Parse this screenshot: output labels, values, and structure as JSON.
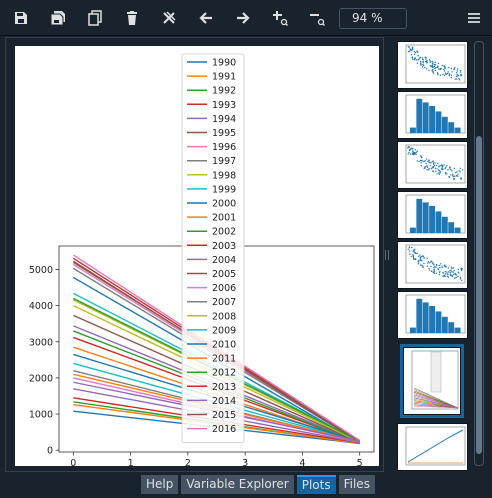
{
  "toolbar": {
    "icons": [
      "save-icon",
      "save-all-icon",
      "copy-icon",
      "delete-icon",
      "delete-all-icon",
      "previous-icon",
      "next-icon",
      "zoom-in-icon",
      "zoom-out-icon",
      "menu-icon"
    ],
    "zoom": "94 %"
  },
  "tabs": [
    {
      "label": "Help",
      "active": false
    },
    {
      "label": "Variable Explorer",
      "active": false
    },
    {
      "label": "Plots",
      "active": true
    },
    {
      "label": "Files",
      "active": false
    }
  ],
  "thumbnails": [
    "scatter",
    "histogram",
    "scatter",
    "histogram",
    "scatter",
    "histogram",
    "line-legend",
    "line"
  ],
  "chart_data": {
    "type": "line",
    "title": "",
    "xlabel": "",
    "ylabel": "",
    "x": [
      0,
      5
    ],
    "xlim": [
      -0.25,
      5.25
    ],
    "ylim": [
      -50,
      5650
    ],
    "xticks": [
      "0",
      "1",
      "2",
      "3",
      "4",
      "5"
    ],
    "yticks": [
      "0",
      "1000",
      "2000",
      "3000",
      "4000",
      "5000"
    ],
    "legend_location": "upper center",
    "series": [
      {
        "name": "1990",
        "color": "#1f77b4",
        "values": [
          4780,
          200
        ]
      },
      {
        "name": "1991",
        "color": "#ff7f0e",
        "values": [
          2850,
          205
        ]
      },
      {
        "name": "1992",
        "color": "#2ca02c",
        "values": [
          1340,
          180
        ]
      },
      {
        "name": "1993",
        "color": "#d62728",
        "values": [
          3120,
          210
        ]
      },
      {
        "name": "1994",
        "color": "#9467bd",
        "values": [
          3440,
          215
        ]
      },
      {
        "name": "1995",
        "color": "#8c564b",
        "values": [
          3730,
          220
        ]
      },
      {
        "name": "1996",
        "color": "#e377c2",
        "values": [
          5140,
          225
        ]
      },
      {
        "name": "1997",
        "color": "#7f7f7f",
        "values": [
          5030,
          230
        ]
      },
      {
        "name": "1998",
        "color": "#bcbd22",
        "values": [
          4160,
          235
        ]
      },
      {
        "name": "1999",
        "color": "#17becf",
        "values": [
          4340,
          240
        ]
      },
      {
        "name": "2000",
        "color": "#1f77b4",
        "values": [
          1080,
          190
        ]
      },
      {
        "name": "2001",
        "color": "#ff7f0e",
        "values": [
          1260,
          195
        ]
      },
      {
        "name": "2002",
        "color": "#2ca02c",
        "values": [
          3300,
          200
        ]
      },
      {
        "name": "2003",
        "color": "#d62728",
        "values": [
          1450,
          205
        ]
      },
      {
        "name": "2004",
        "color": "#9467bd",
        "values": [
          1700,
          210
        ]
      },
      {
        "name": "2005",
        "color": "#8c564b",
        "values": [
          5230,
          215
        ]
      },
      {
        "name": "2006",
        "color": "#e377c2",
        "values": [
          2000,
          220
        ]
      },
      {
        "name": "2007",
        "color": "#7f7f7f",
        "values": [
          2200,
          225
        ]
      },
      {
        "name": "2008",
        "color": "#bcbd22",
        "values": [
          4000,
          230
        ]
      },
      {
        "name": "2009",
        "color": "#17becf",
        "values": [
          2400,
          235
        ]
      },
      {
        "name": "2010",
        "color": "#1f77b4",
        "values": [
          2650,
          240
        ]
      },
      {
        "name": "2011",
        "color": "#ff7f0e",
        "values": [
          2100,
          245
        ]
      },
      {
        "name": "2012",
        "color": "#2ca02c",
        "values": [
          4200,
          250
        ]
      },
      {
        "name": "2013",
        "color": "#d62728",
        "values": [
          5310,
          255
        ]
      },
      {
        "name": "2014",
        "color": "#9467bd",
        "values": [
          1880,
          260
        ]
      },
      {
        "name": "2015",
        "color": "#8c564b",
        "values": [
          5200,
          265
        ]
      },
      {
        "name": "2016",
        "color": "#e377c2",
        "values": [
          5400,
          270
        ]
      }
    ]
  }
}
